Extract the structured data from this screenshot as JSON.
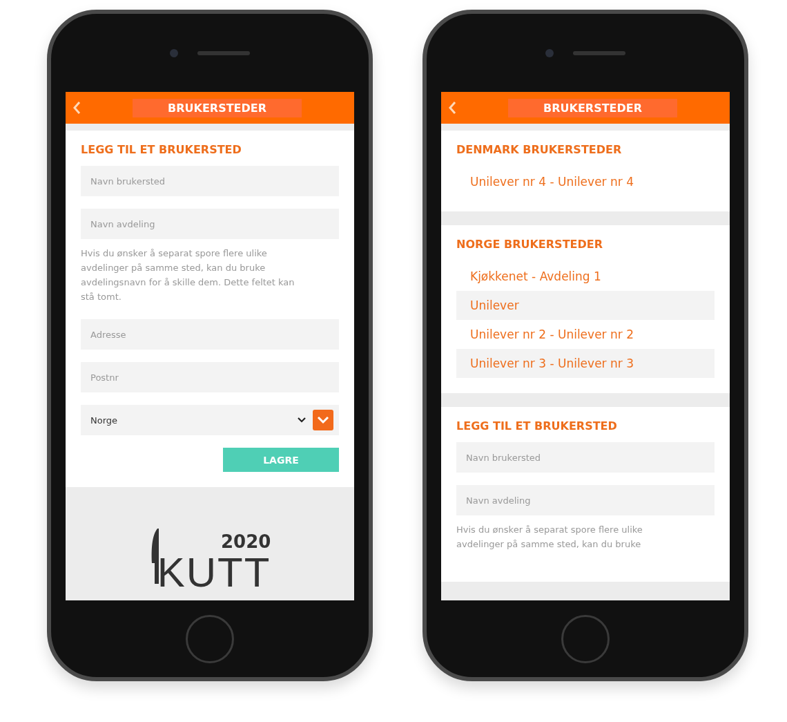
{
  "phones": [
    {
      "header": {
        "title": "BRUKERSTEDER"
      },
      "sections": [
        {
          "kind": "form",
          "title": "LEGG TIL ET BRUKERSTED",
          "fields": [
            {
              "placeholder": "Navn brukersted"
            },
            {
              "placeholder": "Navn avdeling"
            }
          ],
          "hint": "Hvis du ønsker å separat spore flere ulike avdelinger på samme sted, kan du bruke avdelingsnavn for å skille dem. Dette feltet kan stå tomt.",
          "more_fields": [
            {
              "placeholder": "Adresse"
            },
            {
              "placeholder": "Postnr"
            }
          ],
          "select": {
            "value": "Norge"
          },
          "button": "LAGRE"
        },
        {
          "kind": "logo",
          "year": "2020",
          "word": "KUTT"
        }
      ]
    },
    {
      "header": {
        "title": "BRUKERSTEDER"
      },
      "sections": [
        {
          "kind": "list",
          "title": "DENMARK BRUKERSTEDER",
          "items": [
            "Unilever nr 4 - Unilever nr 4"
          ]
        },
        {
          "kind": "list",
          "title": "NORGE BRUKERSTEDER",
          "items": [
            "Kjøkkenet - Avdeling 1",
            "Unilever",
            "Unilever nr 2 - Unilever nr 2",
            "Unilever nr 3 - Unilever nr 3"
          ]
        },
        {
          "kind": "form",
          "title": "LEGG TIL ET BRUKERSTED",
          "fields": [
            {
              "placeholder": "Navn brukersted"
            },
            {
              "placeholder": "Navn avdeling"
            }
          ],
          "hint": "Hvis du ønsker å separat spore flere ulike avdelinger på samme sted, kan du bruke"
        }
      ]
    }
  ]
}
